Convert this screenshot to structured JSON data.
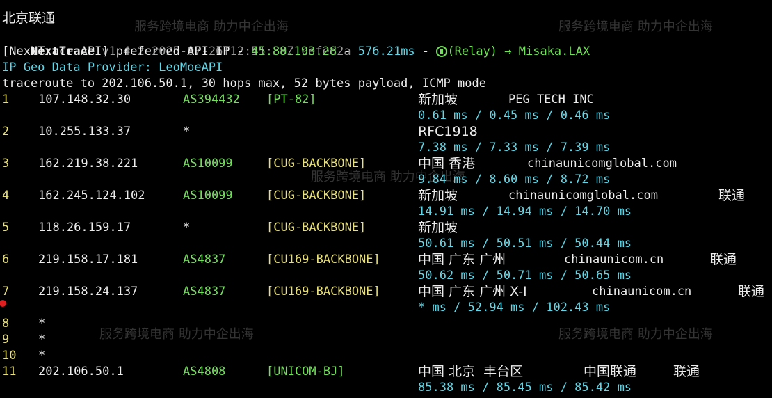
{
  "watermark": {
    "text": "服务跨境电商 助力中企出海"
  },
  "header": {
    "separator": "----------------------------------------------------------------------------------",
    "location": "北京联通",
    "tool_name": "NextTrace",
    "tool_version": "v1.4.2 2025-07-26T12:51:39Z cefed2a",
    "api_label": "[NextTrace API] preferred API IP - ",
    "api_ip": "45.88.193.28",
    "api_dash": " - ",
    "api_latency": "576.21ms",
    "api_dash2": " - ",
    "api_relay": "(Relay) → Misaka.LAX",
    "geo_provider": "IP Geo Data Provider: LeoMoeAPI",
    "traceroute": "traceroute to 202.106.50.1, 30 hops max, 52 bytes payload, ICMP mode"
  },
  "hops": [
    {
      "num": "1",
      "ip": "107.148.32.30",
      "asn": "AS394432",
      "tag": "[PT-82]",
      "geo": "新加坡",
      "org": "PEG TECH INC",
      "extra": "",
      "rtt": "0.61 ms / 0.45 ms / 0.46 ms"
    },
    {
      "num": "2",
      "ip": "10.255.133.37",
      "asn": "*",
      "tag": "",
      "geo": "RFC1918",
      "org": "",
      "extra": "",
      "rtt": "7.38 ms / 7.33 ms / 7.39 ms"
    },
    {
      "num": "3",
      "ip": "162.219.38.221",
      "asn": "AS10099",
      "tag": "[CUG-BACKBONE]",
      "geo": "中国 香港",
      "org": "chinaunicomglobal.com",
      "extra": "",
      "rtt": "9.84 ms / 8.60 ms / 8.72 ms"
    },
    {
      "num": "4",
      "ip": "162.245.124.102",
      "asn": "AS10099",
      "tag": "[CUG-BACKBONE]",
      "geo": "新加坡",
      "org": "chinaunicomglobal.com",
      "extra": "联通",
      "rtt": "14.91 ms / 14.94 ms / 14.70 ms"
    },
    {
      "num": "5",
      "ip": "118.26.159.17",
      "asn": "*",
      "tag": "[CUG-BACKBONE]",
      "geo": "新加坡",
      "org": "",
      "extra": "",
      "rtt": "50.61 ms / 50.51 ms / 50.44 ms"
    },
    {
      "num": "6",
      "ip": "219.158.17.181",
      "asn": "AS4837",
      "tag": "[CU169-BACKBONE]",
      "geo": "中国 广东 广州",
      "org": "chinaunicom.cn",
      "extra": "联通",
      "rtt": "50.62 ms / 50.71 ms / 50.65 ms"
    },
    {
      "num": "7",
      "ip": "219.158.24.137",
      "asn": "AS4837",
      "tag": "[CU169-BACKBONE]",
      "geo": "中国 广东 广州 X-I",
      "org": "chinaunicom.cn",
      "extra": "联通",
      "rtt": "* ms / 52.94 ms / 102.43 ms"
    },
    {
      "num": "8",
      "ip": "*"
    },
    {
      "num": "9",
      "ip": "*"
    },
    {
      "num": "10",
      "ip": "*"
    },
    {
      "num": "11",
      "ip": "202.106.50.1",
      "asn": "AS4808",
      "tag": "[UNICOM-BJ]",
      "geo": "中国 北京  丰台区",
      "org": "中国联通",
      "extra": "联通",
      "rtt": "85.38 ms / 85.45 ms / 85.42 ms"
    }
  ]
}
